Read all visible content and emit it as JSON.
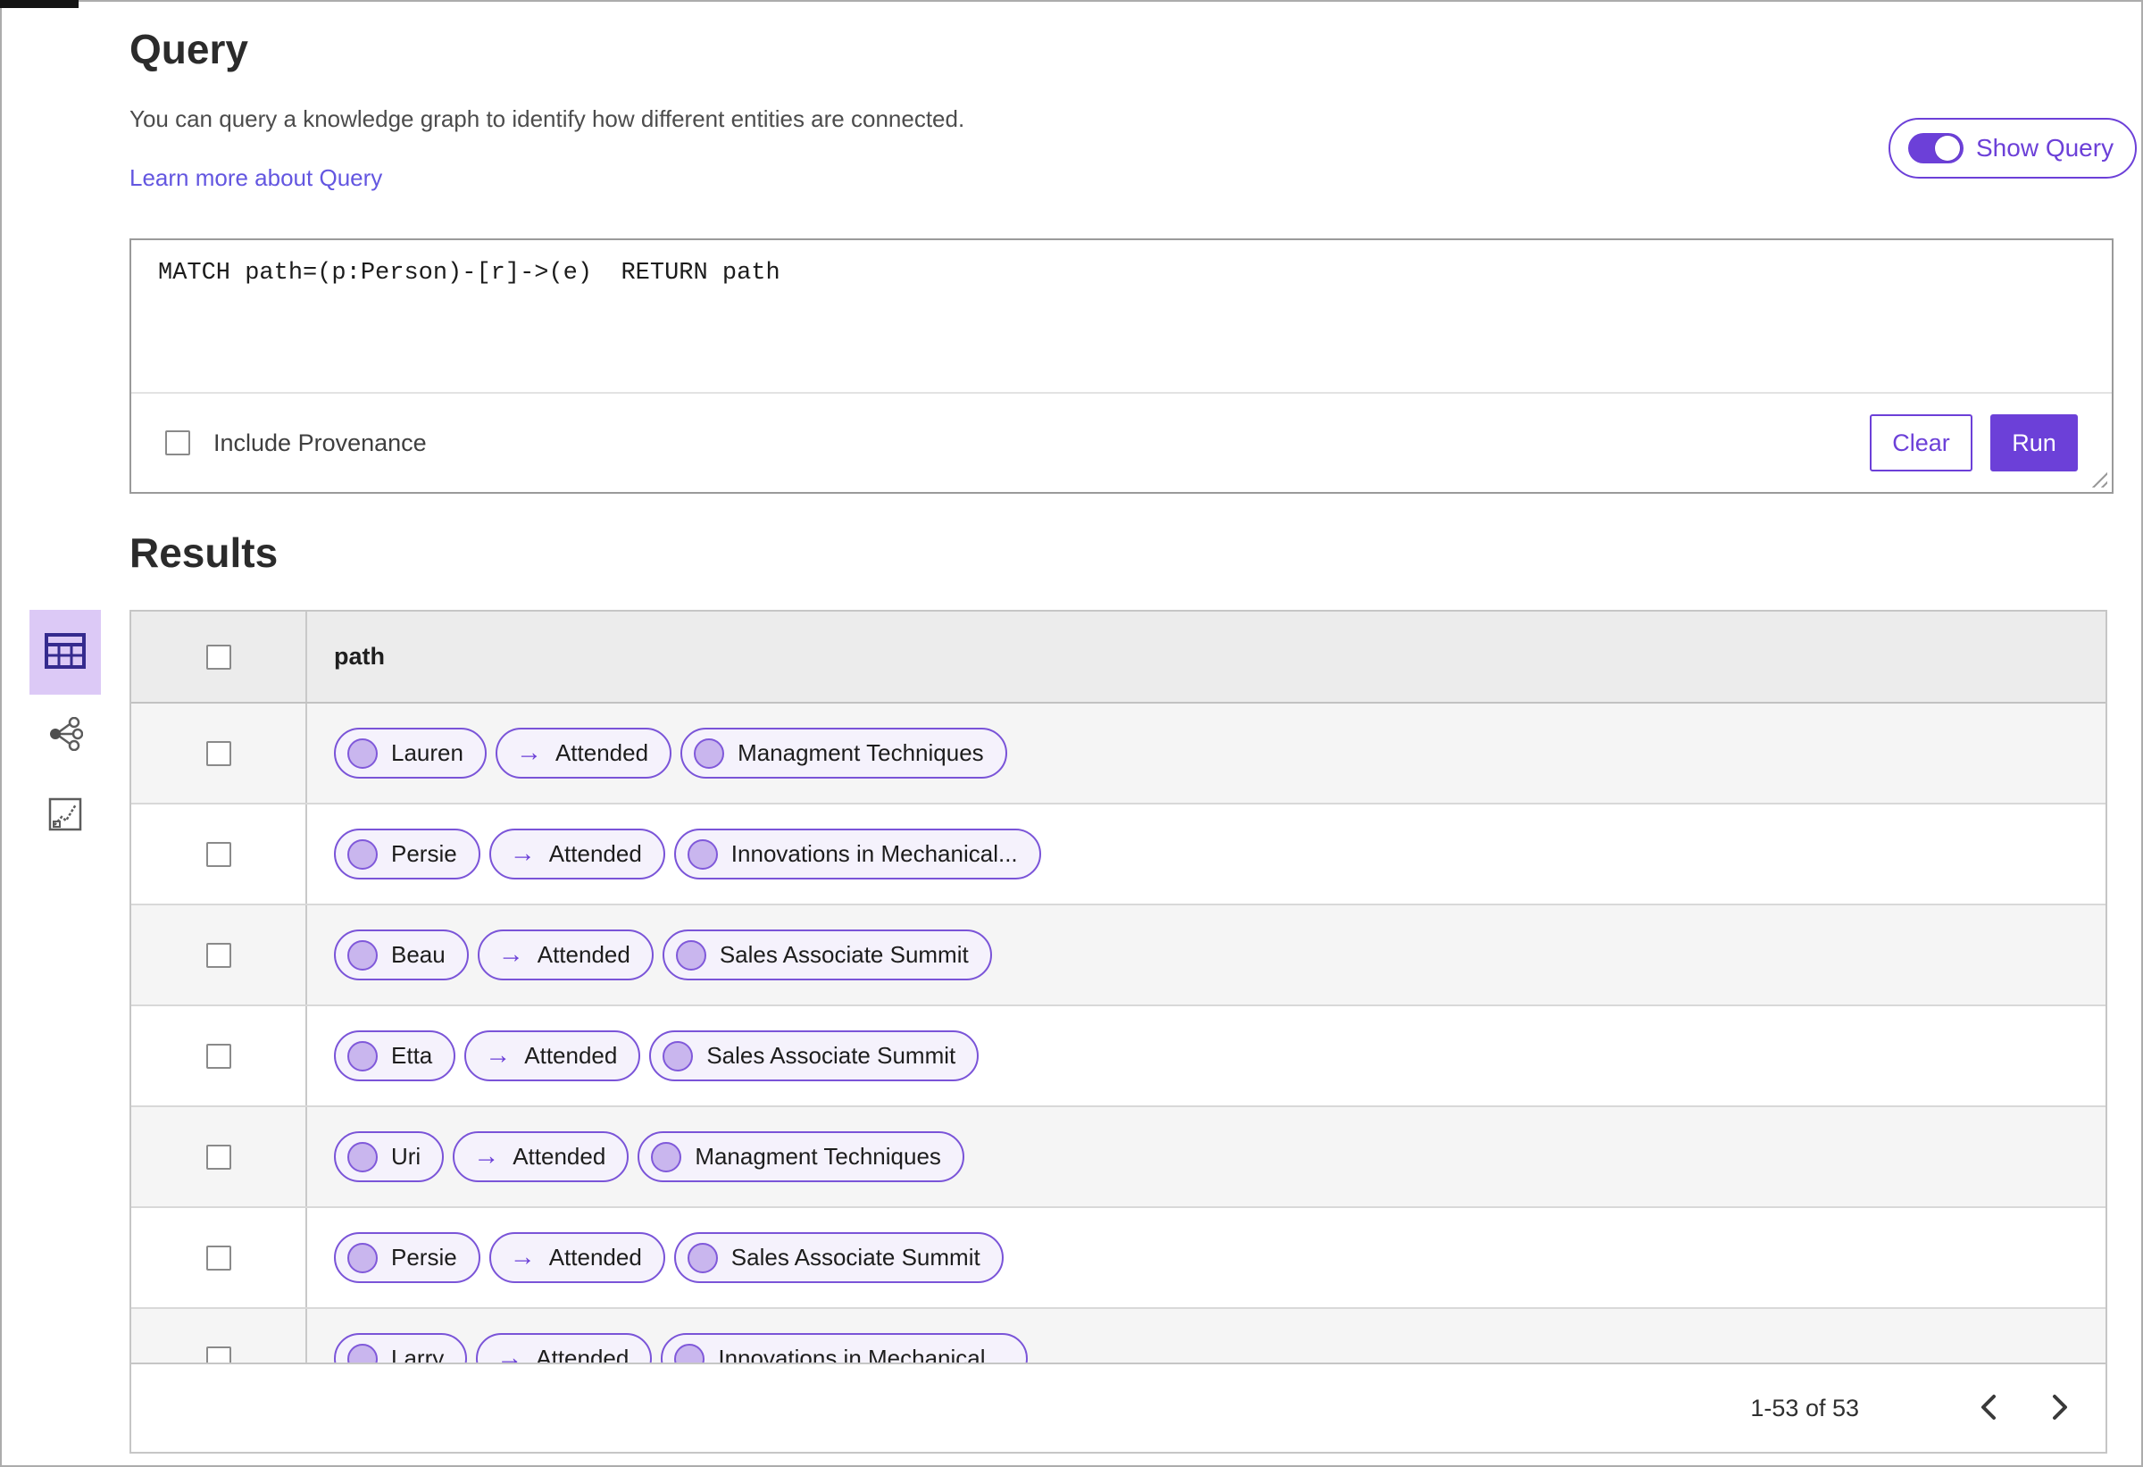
{
  "query_section": {
    "title": "Query",
    "description": "You can query a knowledge graph to identify how different entities are connected.",
    "learn_more_label": "Learn more about Query",
    "show_query_label": "Show Query",
    "show_query_on": true,
    "query_text": "MATCH path=(p:Person)-[r]->(e)  RETURN path",
    "include_provenance_label": "Include Provenance",
    "include_provenance_checked": false,
    "clear_label": "Clear",
    "run_label": "Run"
  },
  "results_section": {
    "title": "Results",
    "views": [
      {
        "name": "table-view",
        "icon": "table-icon",
        "selected": true
      },
      {
        "name": "graph-view",
        "icon": "graph-network-icon",
        "selected": false
      },
      {
        "name": "chart-view",
        "icon": "chart-icon",
        "selected": false
      }
    ],
    "table": {
      "column_header": "path",
      "rows": [
        {
          "path": [
            {
              "type": "node",
              "label": "Lauren"
            },
            {
              "type": "edge",
              "label": "Attended"
            },
            {
              "type": "node",
              "label": "Managment Techniques"
            }
          ]
        },
        {
          "path": [
            {
              "type": "node",
              "label": "Persie"
            },
            {
              "type": "edge",
              "label": "Attended"
            },
            {
              "type": "node",
              "label": "Innovations in Mechanical..."
            }
          ]
        },
        {
          "path": [
            {
              "type": "node",
              "label": "Beau"
            },
            {
              "type": "edge",
              "label": "Attended"
            },
            {
              "type": "node",
              "label": "Sales Associate Summit"
            }
          ]
        },
        {
          "path": [
            {
              "type": "node",
              "label": "Etta"
            },
            {
              "type": "edge",
              "label": "Attended"
            },
            {
              "type": "node",
              "label": "Sales Associate Summit"
            }
          ]
        },
        {
          "path": [
            {
              "type": "node",
              "label": "Uri"
            },
            {
              "type": "edge",
              "label": "Attended"
            },
            {
              "type": "node",
              "label": "Managment Techniques"
            }
          ]
        },
        {
          "path": [
            {
              "type": "node",
              "label": "Persie"
            },
            {
              "type": "edge",
              "label": "Attended"
            },
            {
              "type": "node",
              "label": "Sales Associate Summit"
            }
          ]
        },
        {
          "path": [
            {
              "type": "node",
              "label": "Larry"
            },
            {
              "type": "edge",
              "label": "Attended"
            },
            {
              "type": "node",
              "label": "Innovations in Mechanical..."
            }
          ]
        }
      ]
    },
    "pagination": {
      "range_label": "1-53 of 53"
    }
  },
  "icons": {
    "edge_arrow": "→"
  },
  "colors": {
    "accent": "#6C40D8",
    "link": "#6356E0",
    "pill_border": "#7A54D8",
    "pill_bg": "#F5F2FC",
    "node_fill": "#C9B6EE",
    "selected_view_bg": "#DCC9F6",
    "header_bg": "#ECECEC",
    "row_alt_bg": "#F5F5F5"
  }
}
